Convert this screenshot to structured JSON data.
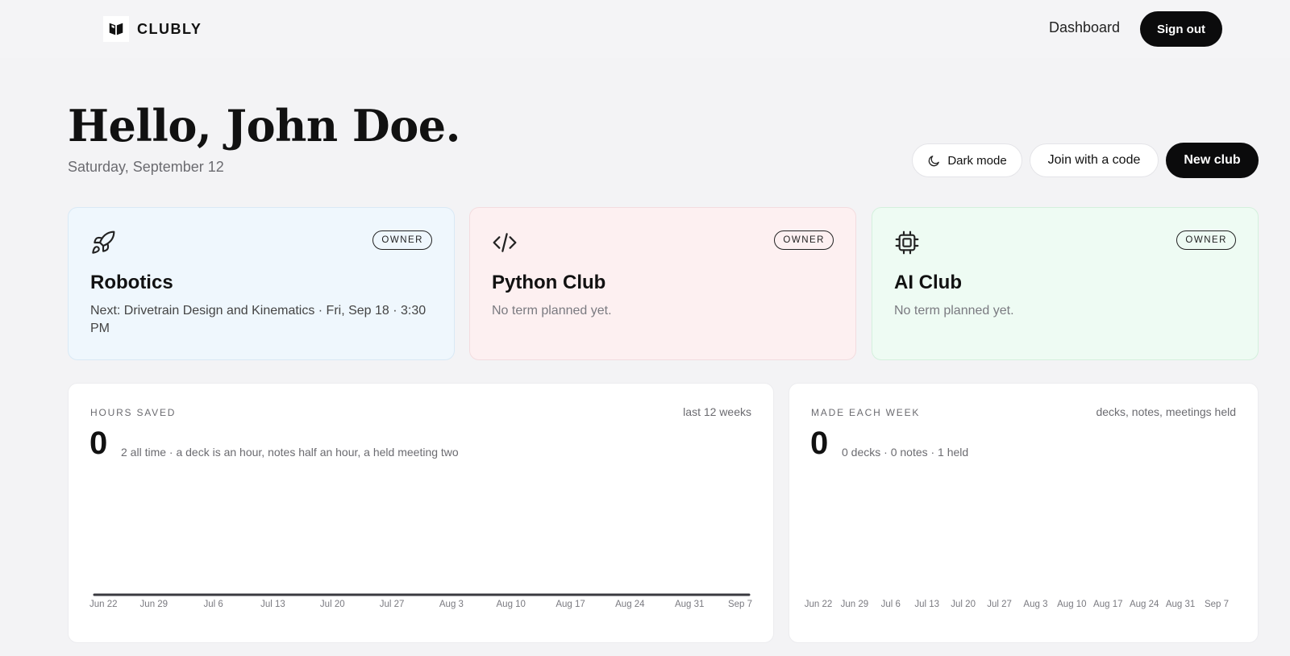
{
  "header": {
    "brand_name": "CLUBLY",
    "brand_icon": "book-icon",
    "nav_link": "Dashboard",
    "sign_out": "Sign out"
  },
  "greeting": {
    "title": "Hello, John Doe.",
    "date": "Saturday, September 12"
  },
  "actions": {
    "dark_mode": "Dark mode",
    "dark_mode_icon": "moon-icon",
    "join": "Join with a code",
    "new_club": "New club"
  },
  "clubs": [
    {
      "icon": "rocket-icon",
      "badge": "OWNER",
      "name": "Robotics",
      "subtitle": "Next: Drivetrain Design and Kinematics · Fri, Sep 18 · 3:30 PM",
      "color": "#eff7fd"
    },
    {
      "icon": "code-icon",
      "badge": "OWNER",
      "name": "Python Club",
      "subtitle": "No term planned yet.",
      "color": "#fdf0f1"
    },
    {
      "icon": "chip-icon",
      "badge": "OWNER",
      "name": "AI Club",
      "subtitle": "No term planned yet.",
      "color": "#eefbf3"
    }
  ],
  "hours_panel": {
    "label": "HOURS SAVED",
    "meta": "last 12 weeks",
    "value": "0",
    "note": "2 all time · a deck is an hour, notes half an hour, a held meeting two"
  },
  "weekly_panel": {
    "label": "MADE EACH WEEK",
    "meta": "decks, notes, meetings held",
    "value": "0",
    "note": "0 decks · 0 notes · 1 held"
  },
  "chart_data": [
    {
      "type": "line",
      "categories": [
        "Jun 22",
        "Jun 29",
        "Jul 6",
        "Jul 13",
        "Jul 20",
        "Jul 27",
        "Aug 3",
        "Aug 10",
        "Aug 17",
        "Aug 24",
        "Aug 31",
        "Sep 7"
      ],
      "series": [
        {
          "values": [
            0,
            0,
            0,
            0,
            0,
            0,
            0,
            0,
            0,
            0,
            0,
            0
          ]
        }
      ],
      "line_color": "#3a3a40"
    },
    {
      "type": "bar",
      "categories": [
        "Jun 22",
        "Jun 29",
        "Jul 6",
        "Jul 13",
        "Jul 20",
        "Jul 27",
        "Aug 3",
        "Aug 10",
        "Aug 17",
        "Aug 24",
        "Aug 31",
        "Sep 7"
      ],
      "series": [
        {
          "values": [
            0,
            0,
            0,
            0,
            0,
            0,
            0,
            0,
            0,
            0,
            0,
            0
          ]
        }
      ]
    }
  ]
}
